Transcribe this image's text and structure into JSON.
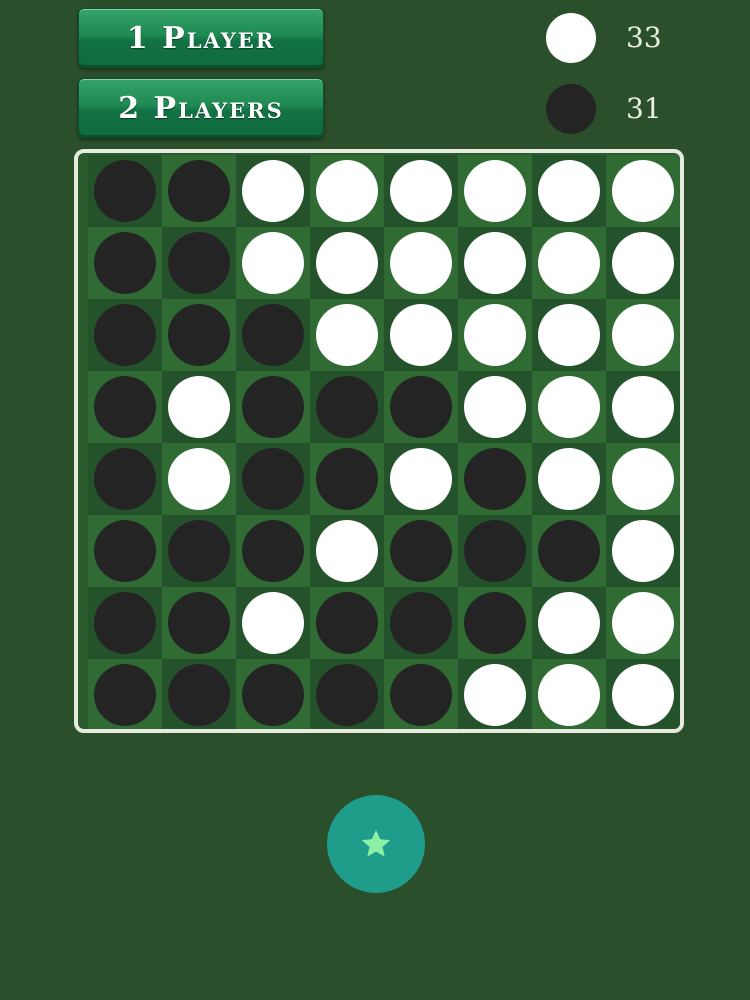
{
  "menu": {
    "one_player_label": "1 Player",
    "two_players_label": "2 Players"
  },
  "score": {
    "white_count": "33",
    "black_count": "31"
  },
  "colors": {
    "background": "#2b4f2a",
    "button_green": "#1f8a52",
    "star_button": "#1f9c8a",
    "star_icon": "#8ef0a8",
    "white_disc": "#ffffff",
    "black_disc": "#242424"
  },
  "board": {
    "rows": [
      [
        "B",
        "B",
        "W",
        "W",
        "W",
        "W",
        "W",
        "W"
      ],
      [
        "B",
        "B",
        "W",
        "W",
        "W",
        "W",
        "W",
        "W"
      ],
      [
        "B",
        "B",
        "B",
        "W",
        "W",
        "W",
        "W",
        "W"
      ],
      [
        "B",
        "W",
        "B",
        "B",
        "B",
        "W",
        "W",
        "W"
      ],
      [
        "B",
        "W",
        "B",
        "B",
        "W",
        "B",
        "W",
        "W"
      ],
      [
        "B",
        "B",
        "B",
        "W",
        "B",
        "B",
        "B",
        "W"
      ],
      [
        "B",
        "B",
        "W",
        "B",
        "B",
        "B",
        "W",
        "W"
      ],
      [
        "B",
        "B",
        "B",
        "B",
        "B",
        "W",
        "W",
        "W"
      ]
    ]
  },
  "star_button_icon": "star-icon"
}
